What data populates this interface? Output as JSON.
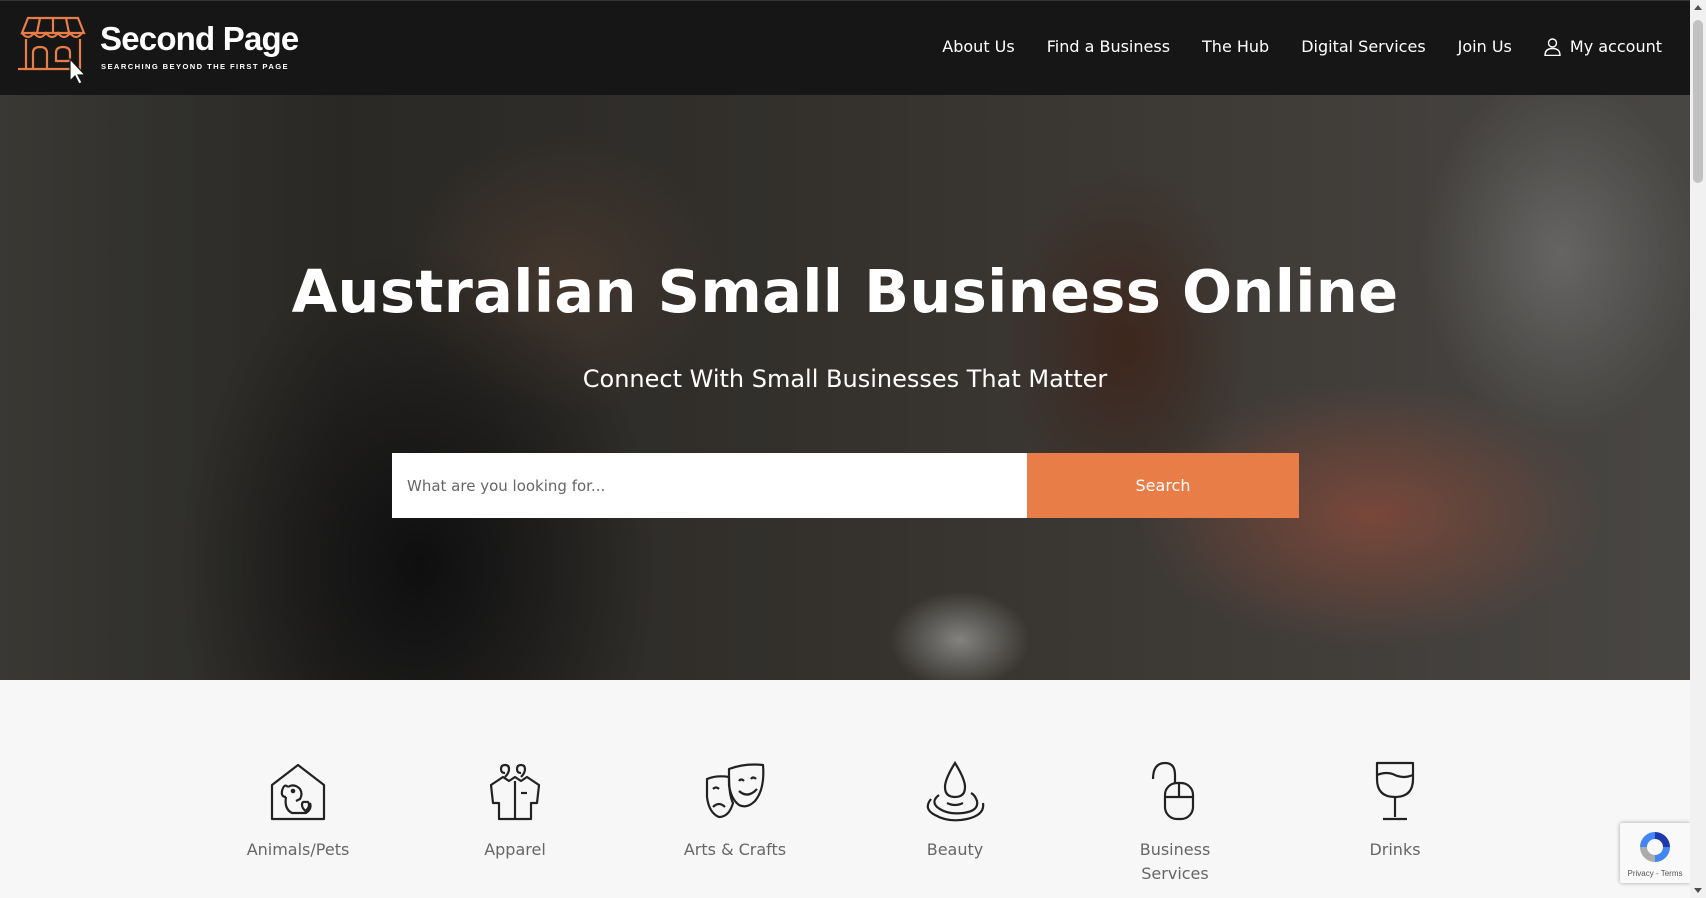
{
  "header": {
    "logo_title": "Second Page",
    "logo_tagline": "SEARCHING BEYOND THE FIRST PAGE",
    "nav": [
      {
        "label": "About Us"
      },
      {
        "label": "Find a Business"
      },
      {
        "label": "The Hub"
      },
      {
        "label": "Digital Services"
      },
      {
        "label": "Join Us"
      }
    ],
    "account_label": "My account"
  },
  "hero": {
    "title": "Australian Small Business Online",
    "subtitle": "Connect With Small Businesses That Matter",
    "search_placeholder": "What are you looking for...",
    "search_button": "Search"
  },
  "categories": [
    {
      "label": "Animals/Pets",
      "icon": "pet-house-icon"
    },
    {
      "label": "Apparel",
      "icon": "shirt-hanger-icon"
    },
    {
      "label": "Arts & Crafts",
      "icon": "theatre-masks-icon"
    },
    {
      "label": "Beauty",
      "icon": "water-drop-icon"
    },
    {
      "label": "Business Services",
      "icon": "mouse-icon"
    },
    {
      "label": "Drinks",
      "icon": "wine-glass-icon"
    }
  ],
  "recaptcha": {
    "links": "Privacy - Terms"
  },
  "colors": {
    "accent": "#e87d47",
    "header_bg": "#161616",
    "page_bg": "#f7f7f7"
  }
}
